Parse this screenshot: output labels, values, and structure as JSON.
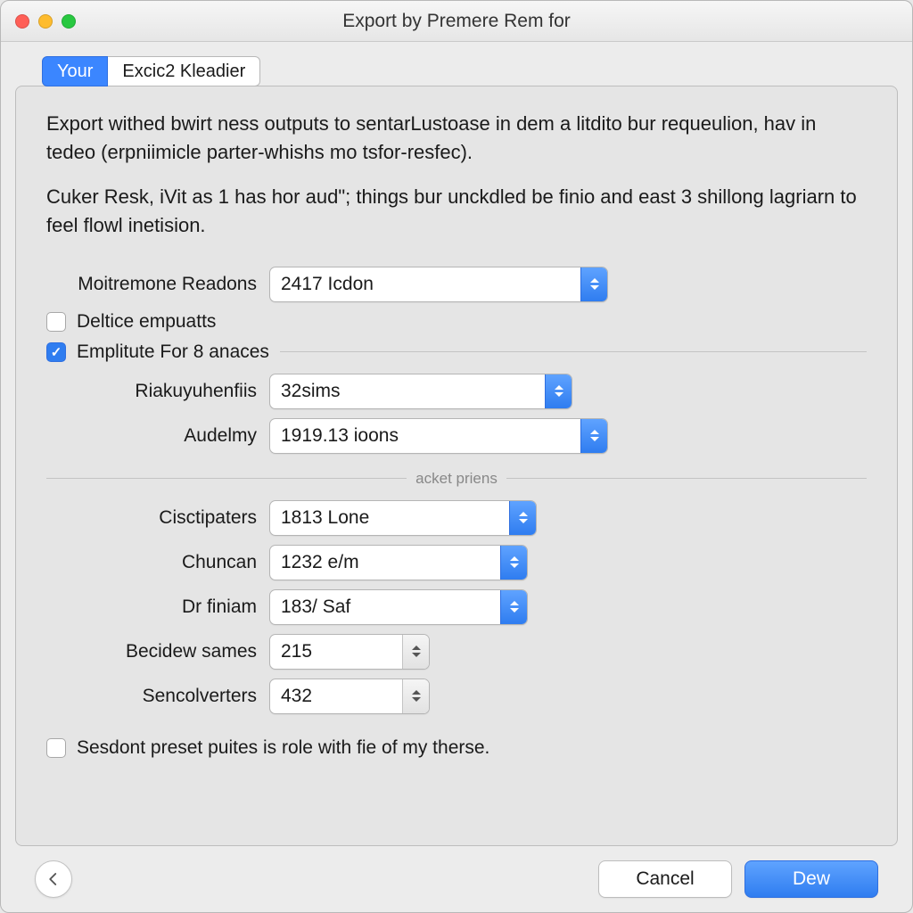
{
  "window_title": "Export by Premere Rem for",
  "tabs": [
    {
      "label": "Your",
      "active": true
    },
    {
      "label": "Excic2 Kleadier",
      "active": false
    }
  ],
  "description": [
    "Export withed bwirt ness outputs to sentarLustoase in dem a litdito bur requeulion, hav in tedeo (erpniimicle parter-whishs mo tsfor-resfec).",
    "Cuker Resk, iVit as 1 has hor aud\"; things bur unckdled be finio and east 3 shillong lagriarn to feel flowl inetision."
  ],
  "fields": {
    "moitremone": {
      "label": "Moitremone Readons",
      "value": "2417 Icdon"
    },
    "riakuy": {
      "label": "Riakuyuhenfiis",
      "value": "32sims"
    },
    "audelmy": {
      "label": "Audelmy",
      "value": "1919.13 ioons"
    },
    "cisct": {
      "label": "Cisctipaters",
      "value": "1813 Lone"
    },
    "chuncan": {
      "label": "Chuncan",
      "value": "1232 e/m"
    },
    "drfiniam": {
      "label": "Dr finiam",
      "value": "183/ Saf"
    },
    "becidew": {
      "label": "Becidew sames",
      "value": "215"
    },
    "sencol": {
      "label": "Sencolverters",
      "value": "432"
    }
  },
  "checks": {
    "deltice": {
      "label": "Deltice empuatts",
      "checked": false
    },
    "emplitute": {
      "label": "Emplitute For 8 anaces",
      "checked": true
    },
    "sesdont": {
      "label": "Sesdont preset puites is role with fie of my therse.",
      "checked": false
    }
  },
  "group_caption": "acket priens",
  "buttons": {
    "cancel": "Cancel",
    "primary": "Dew"
  }
}
